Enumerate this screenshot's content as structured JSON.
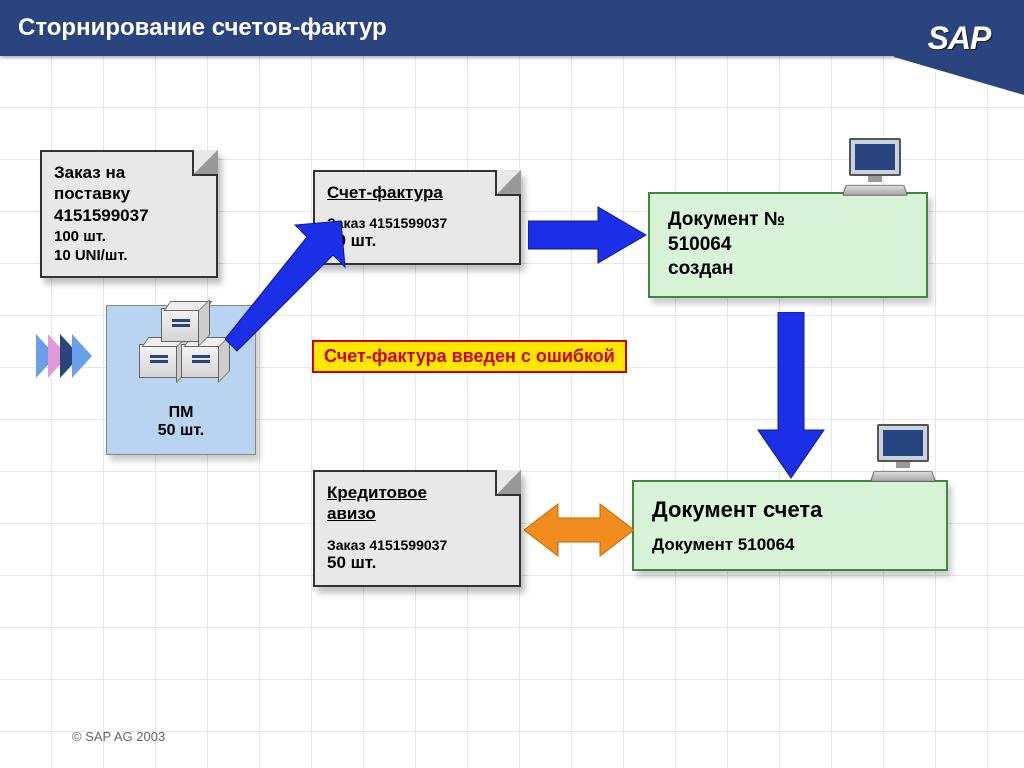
{
  "header": {
    "title": "Сторнирование счетов-фактур"
  },
  "logo": {
    "text": "SAP"
  },
  "po_note": {
    "line1": "Заказ на",
    "line2": "поставку",
    "number": "4151599037",
    "qty": "100 шт.",
    "price": "10 UNI/шт."
  },
  "invoice_note": {
    "title": "Счет-фактура",
    "order": "Заказ 4151599037",
    "qty": "50 шт."
  },
  "credit_note": {
    "title1": "Кредитовое",
    "title2": "авизо",
    "order": "Заказ 4151599037",
    "qty": "50 шт."
  },
  "doc_created": {
    "line1": "Документ №",
    "line2": "510064",
    "line3": "создан"
  },
  "doc_account": {
    "title": "Документ счета",
    "sub": "Документ 510064"
  },
  "warning": {
    "text": "Счет-фактура введен с ошибкой"
  },
  "pm": {
    "label": "ПМ",
    "qty": "50 шт."
  },
  "footer": {
    "copyright": "©  SAP AG 2003"
  }
}
